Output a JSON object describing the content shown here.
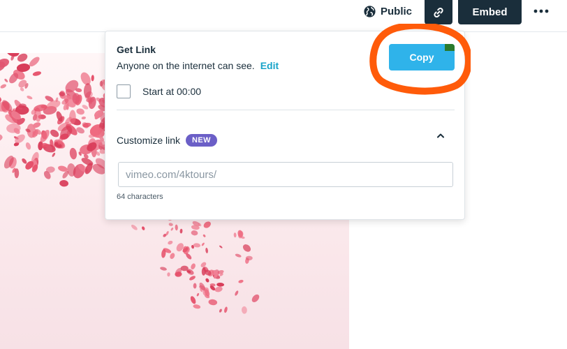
{
  "topbar": {
    "public_label": "Public",
    "public_icon": "globe-icon",
    "link_icon": "link-icon",
    "embed_label": "Embed",
    "more_icon": "more-horizontal-icon"
  },
  "popover": {
    "title": "Get Link",
    "description": "Anyone on the internet can see.",
    "edit_label": "Edit",
    "copy_label": "Copy",
    "start_at_label": "Start at 00:00",
    "start_at_checked": false,
    "customize_label": "Customize link",
    "new_badge": "NEW",
    "collapse_icon": "chevron-up-icon",
    "url_value": "",
    "url_placeholder": "vimeo.com/4ktours/",
    "char_count": "64 characters"
  },
  "colors": {
    "dark_button": "#1a2e3b",
    "copy_button": "#2fb3ea",
    "edit_link": "#17a3c9",
    "new_badge": "#6b5fc7",
    "annotation": "#ff5b0a",
    "petal": "#e6506a"
  }
}
